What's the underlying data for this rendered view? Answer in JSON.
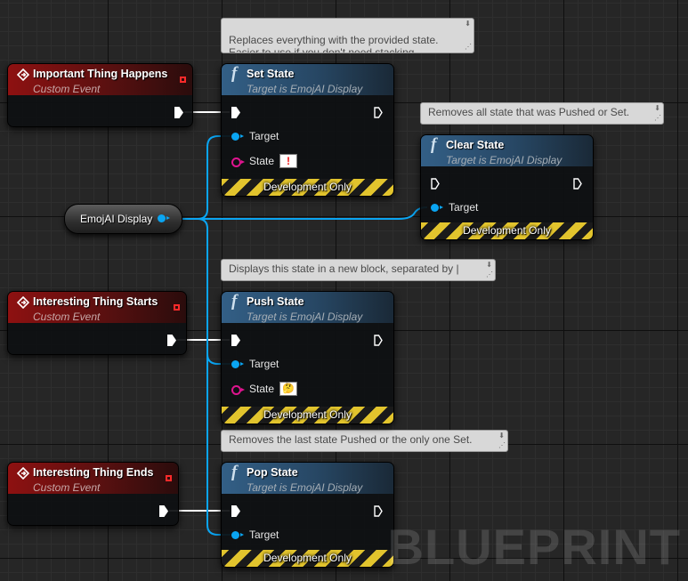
{
  "colors": {
    "exec_wire": "#ffffff",
    "object_wire": "#0aa5f2",
    "struct_pin": "#e0148f",
    "event_header": "#8e1111",
    "function_header": "#335f86"
  },
  "comments": {
    "set_state": "Replaces everything with the provided state.\nEasier to use if you don't need stacking.",
    "clear_state": "Removes all state that was Pushed or Set.",
    "push_state": "Displays this state in a new block, separated by |",
    "pop_state": "Removes the last state Pushed or the only one Set."
  },
  "events": [
    {
      "title": "Important Thing Happens",
      "subtitle": "Custom Event",
      "icon": "event-diamond-icon"
    },
    {
      "title": "Interesting Thing Starts",
      "subtitle": "Custom Event",
      "icon": "event-diamond-icon"
    },
    {
      "title": "Interesting Thing Ends",
      "subtitle": "Custom Event",
      "icon": "event-diamond-icon"
    }
  ],
  "functions": {
    "set_state": {
      "title": "Set State",
      "subtitle": "Target is EmojAI Display",
      "target_label": "Target",
      "state_label": "State",
      "state_value": "!",
      "footer": "Development Only"
    },
    "clear_state": {
      "title": "Clear State",
      "subtitle": "Target is EmojAI Display",
      "target_label": "Target",
      "footer": "Development Only"
    },
    "push_state": {
      "title": "Push State",
      "subtitle": "Target is EmojAI Display",
      "target_label": "Target",
      "state_label": "State",
      "state_value": "🤔",
      "footer": "Development Only"
    },
    "pop_state": {
      "title": "Pop State",
      "subtitle": "Target is EmojAI Display",
      "target_label": "Target",
      "footer": "Development Only"
    }
  },
  "variable": {
    "label": "EmojAI Display"
  },
  "watermark": "BLUEPRINT"
}
